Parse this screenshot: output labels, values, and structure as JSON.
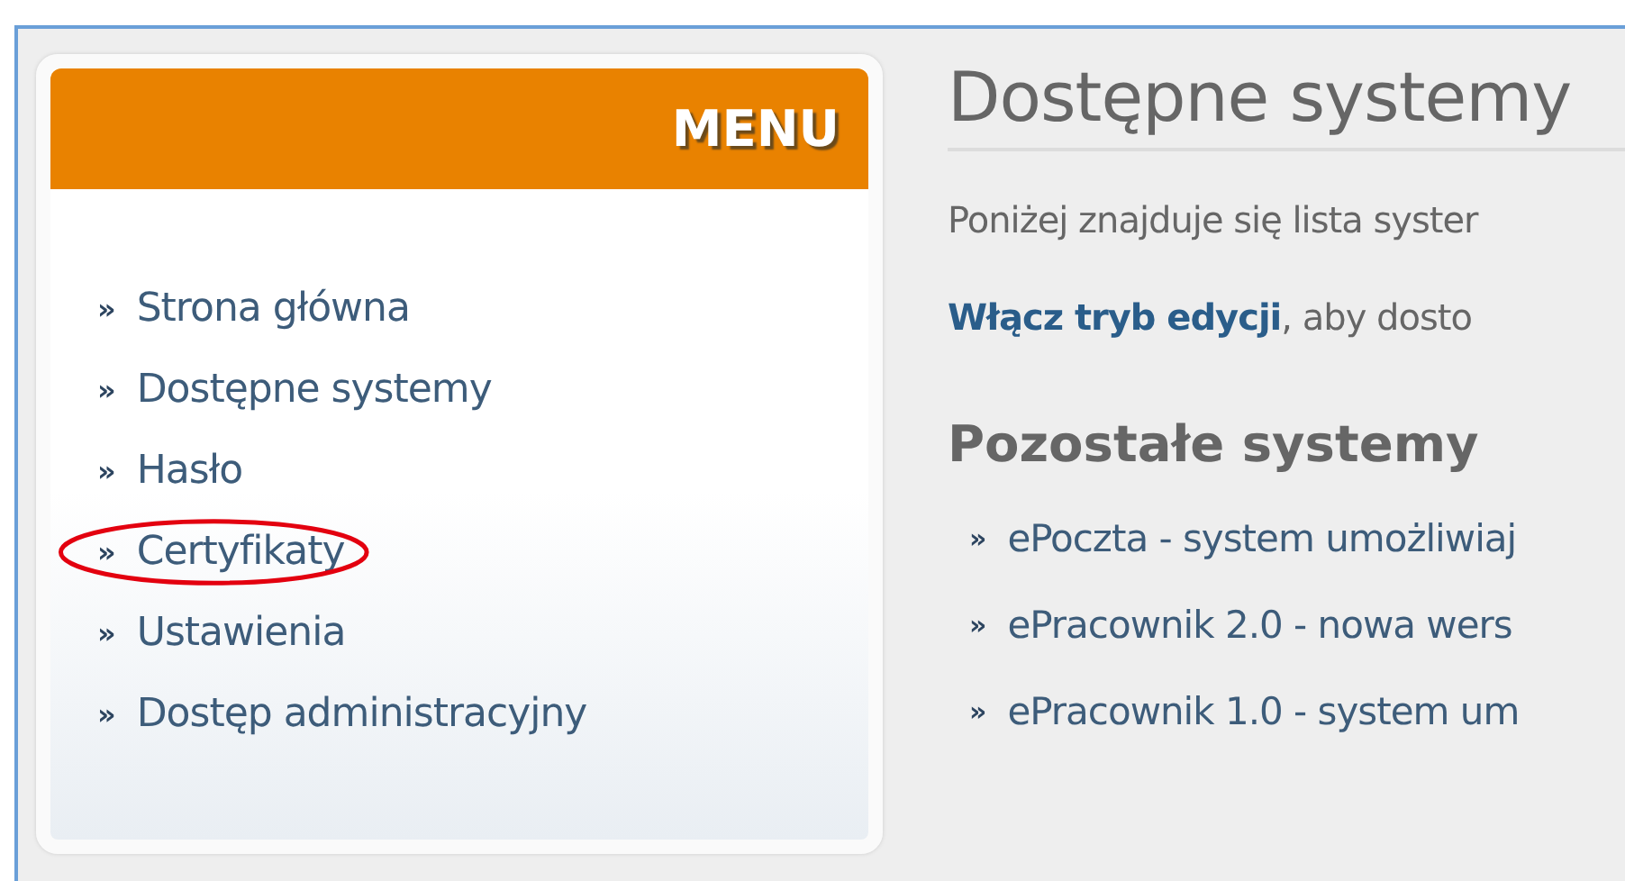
{
  "menu": {
    "title": "MENU",
    "items": [
      {
        "marker": "»",
        "label": "Strona główna",
        "highlighted": false
      },
      {
        "marker": "»",
        "label": "Dostępne systemy",
        "highlighted": false
      },
      {
        "marker": "»",
        "label": "Hasło",
        "highlighted": false
      },
      {
        "marker": "»",
        "label": "Certyfikaty",
        "highlighted": true
      },
      {
        "marker": "»",
        "label": "Ustawienia",
        "highlighted": false
      },
      {
        "marker": "»",
        "label": "Dostęp administracyjny",
        "highlighted": false
      }
    ]
  },
  "content": {
    "title": "Dostępne systemy",
    "intro": "Poniżej znajduje się lista syster",
    "edit_link": "Włącz tryb edycji",
    "edit_rest": ", aby dosto",
    "section_title": "Pozostałe systemy",
    "systems": [
      {
        "marker": "»",
        "label": "ePoczta - system umożliwiaj"
      },
      {
        "marker": "»",
        "label": "ePracownik 2.0 - nowa wers"
      },
      {
        "marker": "»",
        "label": "ePracownik 1.0 - system um"
      }
    ]
  }
}
